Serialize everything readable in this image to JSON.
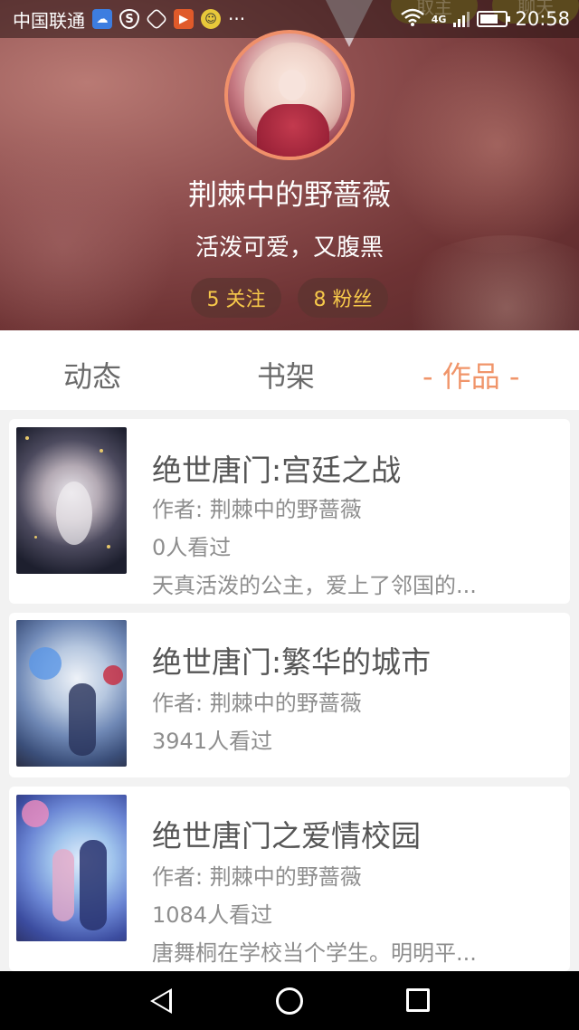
{
  "status_bar": {
    "carrier": "中国联通",
    "extra_icons": [
      "cloud-sync-icon",
      "shield-icon",
      "hexagon-icon",
      "video-play-icon",
      "ai-face-icon"
    ],
    "more": "···",
    "network": "4G",
    "time": "20:58",
    "battery_level": 0.72
  },
  "header_buttons": {
    "left_partial": "取主",
    "right_partial": "聊天"
  },
  "profile": {
    "name": "荆棘中的野蔷薇",
    "bio": "活泼可爱，又腹黑",
    "follow_label": "5 关注",
    "fans_label": "8 粉丝"
  },
  "tabs": {
    "items": [
      "动态",
      "书架",
      "- 作品 -"
    ],
    "active": 2
  },
  "books": [
    {
      "title": "绝世唐门:宫廷之战",
      "author": "作者: 荆棘中的野蔷薇",
      "views": "0人看过",
      "summary": "天真活泼的公主，爱上了邻国的..."
    },
    {
      "title": "绝世唐门:繁华的城市",
      "author": "作者: 荆棘中的野蔷薇",
      "views": "3941人看过",
      "summary": ""
    },
    {
      "title": "绝世唐门之爱情校园",
      "author": "作者: 荆棘中的野蔷薇",
      "views": "1084人看过",
      "summary": "唐舞桐在学校当个学生。明明平..."
    }
  ],
  "colors": {
    "accent_orange": "#f0956a",
    "fans_yellow": "#f7c94a",
    "hero_red": "#7a3d3e"
  }
}
